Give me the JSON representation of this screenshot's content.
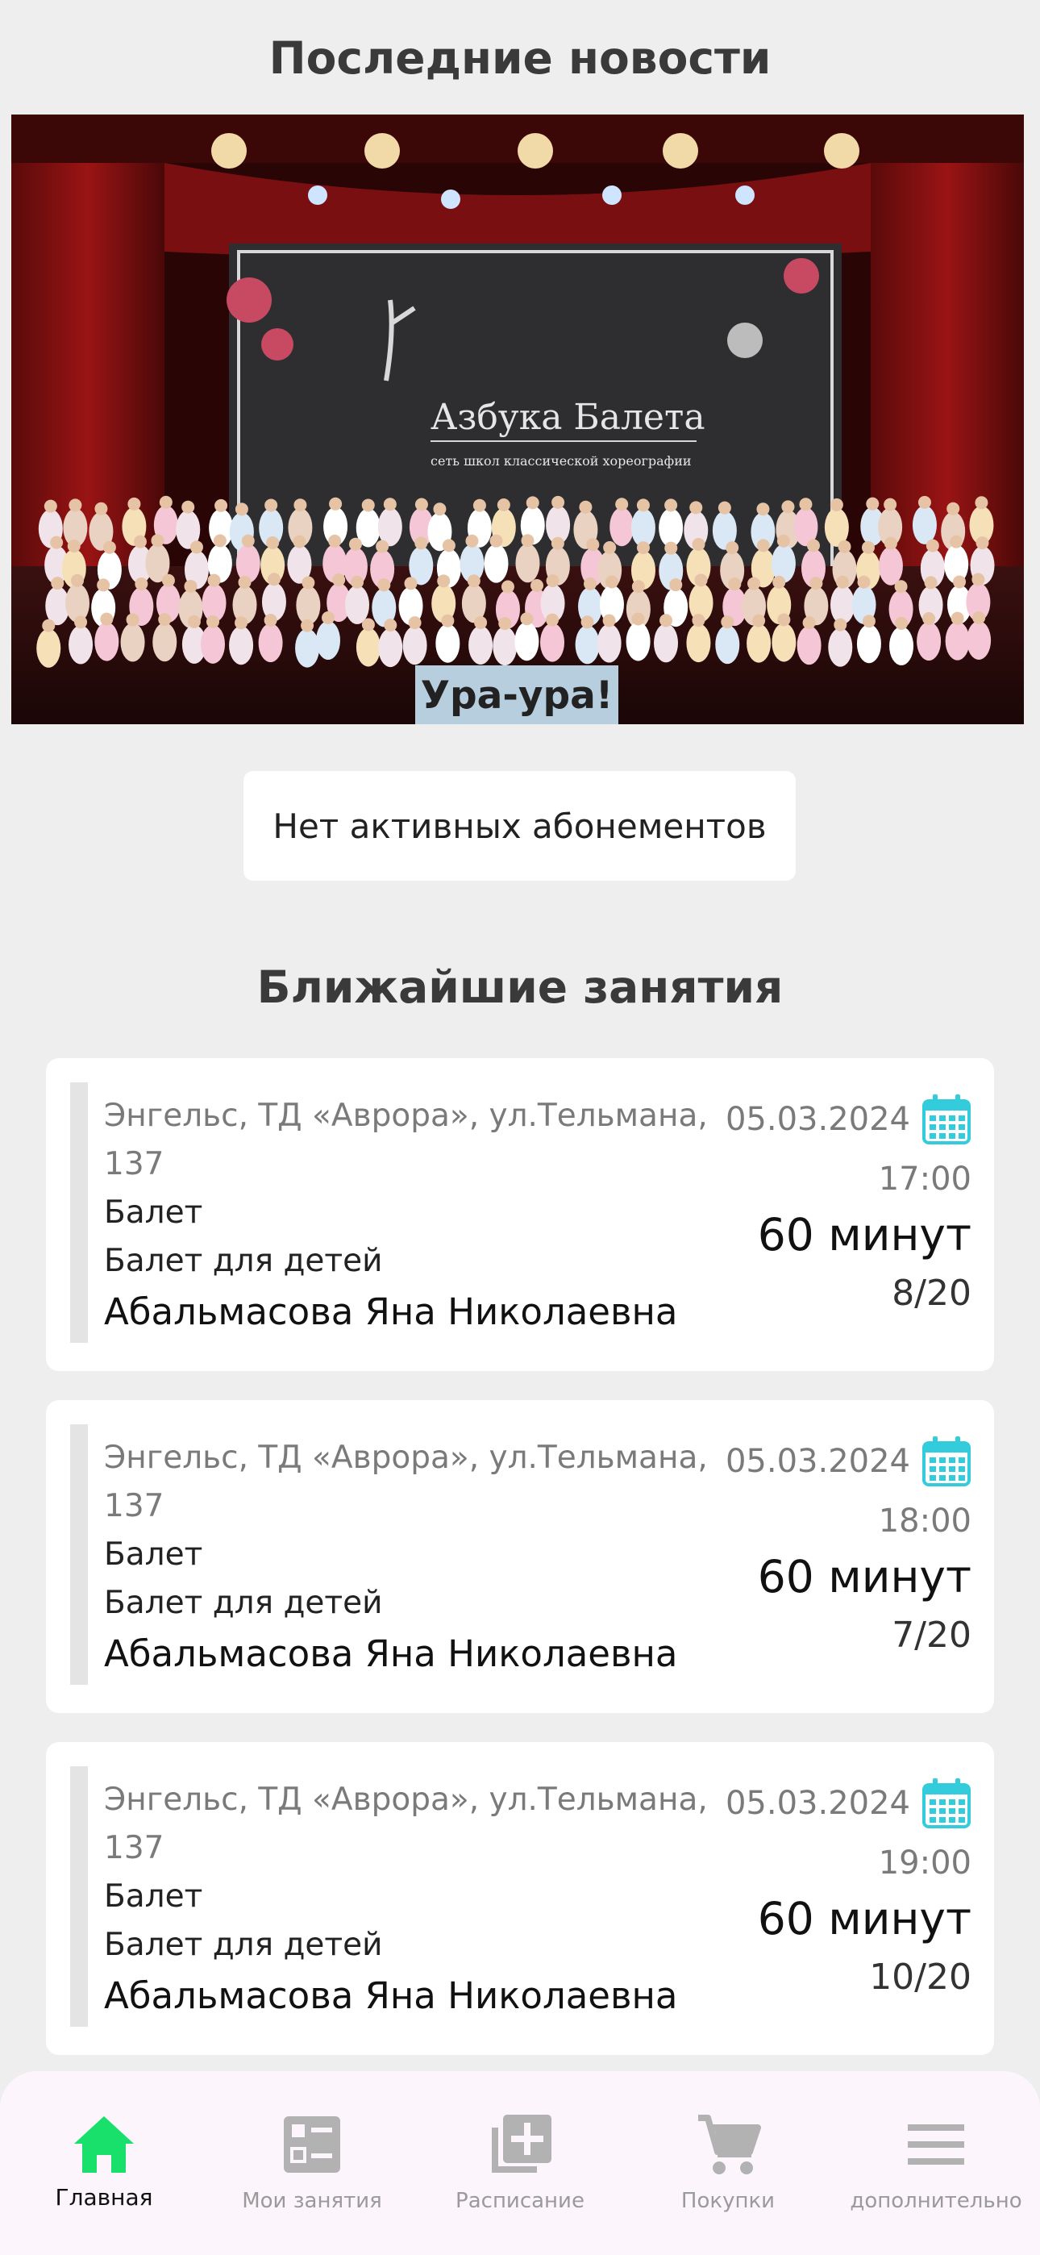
{
  "news": {
    "title": "Последние новости",
    "banner": {
      "sign_title": "Азбука Балета",
      "sign_subtitle": "сеть школ классической хореографии"
    },
    "caption": "Ура-ура!"
  },
  "subscriptions": {
    "empty_text": "Нет активных абонементов"
  },
  "lessons": {
    "title": "Ближайшие занятия",
    "items": [
      {
        "address_line1": "Энгельс, ТД «Аврора», ул.Тельмана,",
        "address_line2": "137",
        "discipline": "Балет",
        "group": "Балет для детей",
        "teacher": "Абальмасова Яна Николаевна",
        "date": "05.03.2024",
        "time": "17:00",
        "duration": "60 минут",
        "spots": "8/20"
      },
      {
        "address_line1": "Энгельс, ТД «Аврора», ул.Тельмана,",
        "address_line2": "137",
        "discipline": "Балет",
        "group": "Балет для детей",
        "teacher": "Абальмасова Яна Николаевна",
        "date": "05.03.2024",
        "time": "18:00",
        "duration": "60 минут",
        "spots": "7/20"
      },
      {
        "address_line1": "Энгельс, ТД «Аврора», ул.Тельмана,",
        "address_line2": "137",
        "discipline": "Балет",
        "group": "Балет для детей",
        "teacher": "Абальмасова Яна Николаевна",
        "date": "05.03.2024",
        "time": "19:00",
        "duration": "60 минут",
        "spots": "10/20"
      }
    ]
  },
  "nav": {
    "items": [
      {
        "label": "Главная",
        "icon": "home-icon",
        "active": true
      },
      {
        "label": "Мои занятия",
        "icon": "checklist-icon",
        "active": false
      },
      {
        "label": "Расписание",
        "icon": "add-library-icon",
        "active": false
      },
      {
        "label": "Покупки",
        "icon": "cart-icon",
        "active": false
      },
      {
        "label": "дополнительно",
        "icon": "menu-icon",
        "active": false
      }
    ]
  },
  "colors": {
    "background": "#eeeeee",
    "card": "#ffffff",
    "accent_green": "#19e06b",
    "calendar_cyan": "#33ccdd",
    "nav_inactive": "#9a9a9a"
  }
}
